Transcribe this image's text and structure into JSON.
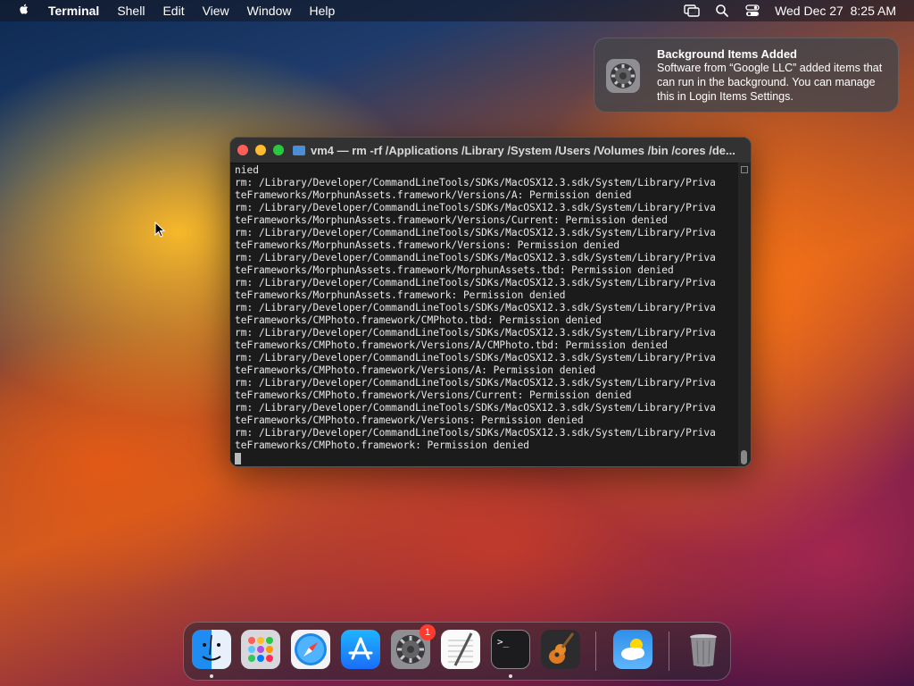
{
  "menubar": {
    "app_name": "Terminal",
    "items": [
      "Shell",
      "Edit",
      "View",
      "Window",
      "Help"
    ],
    "clock": "Wed Dec 27  8:25 AM"
  },
  "notification": {
    "title": "Background Items Added",
    "body": "Software from “Google LLC” added items that can run in the background. You can manage this in Login Items Settings."
  },
  "terminal": {
    "title": "vm4 — rm -rf /Applications /Library /System /Users /Volumes /bin /cores /de...",
    "lines": [
      "nied",
      "rm: /Library/Developer/CommandLineTools/SDKs/MacOSX12.3.sdk/System/Library/Priva",
      "teFrameworks/MorphunAssets.framework/Versions/A: Permission denied",
      "rm: /Library/Developer/CommandLineTools/SDKs/MacOSX12.3.sdk/System/Library/Priva",
      "teFrameworks/MorphunAssets.framework/Versions/Current: Permission denied",
      "rm: /Library/Developer/CommandLineTools/SDKs/MacOSX12.3.sdk/System/Library/Priva",
      "teFrameworks/MorphunAssets.framework/Versions: Permission denied",
      "rm: /Library/Developer/CommandLineTools/SDKs/MacOSX12.3.sdk/System/Library/Priva",
      "teFrameworks/MorphunAssets.framework/MorphunAssets.tbd: Permission denied",
      "rm: /Library/Developer/CommandLineTools/SDKs/MacOSX12.3.sdk/System/Library/Priva",
      "teFrameworks/MorphunAssets.framework: Permission denied",
      "rm: /Library/Developer/CommandLineTools/SDKs/MacOSX12.3.sdk/System/Library/Priva",
      "teFrameworks/CMPhoto.framework/CMPhoto.tbd: Permission denied",
      "rm: /Library/Developer/CommandLineTools/SDKs/MacOSX12.3.sdk/System/Library/Priva",
      "teFrameworks/CMPhoto.framework/Versions/A/CMPhoto.tbd: Permission denied",
      "rm: /Library/Developer/CommandLineTools/SDKs/MacOSX12.3.sdk/System/Library/Priva",
      "teFrameworks/CMPhoto.framework/Versions/A: Permission denied",
      "rm: /Library/Developer/CommandLineTools/SDKs/MacOSX12.3.sdk/System/Library/Priva",
      "teFrameworks/CMPhoto.framework/Versions/Current: Permission denied",
      "rm: /Library/Developer/CommandLineTools/SDKs/MacOSX12.3.sdk/System/Library/Priva",
      "teFrameworks/CMPhoto.framework/Versions: Permission denied",
      "rm: /Library/Developer/CommandLineTools/SDKs/MacOSX12.3.sdk/System/Library/Priva",
      "teFrameworks/CMPhoto.framework: Permission denied"
    ]
  },
  "dock": {
    "system_settings_badge": "1",
    "apps": [
      "finder-icon",
      "launchpad-icon",
      "safari-icon",
      "app-store-icon",
      "system-settings-icon",
      "textedit-icon",
      "terminal-icon",
      "garageband-icon",
      "weather-icon",
      "trash-icon"
    ],
    "terminal_prompt": ">_"
  },
  "colors": {
    "close": "#ff5f57",
    "minimize": "#febc2e",
    "zoom": "#28c840",
    "badge": "#ff3b30"
  }
}
